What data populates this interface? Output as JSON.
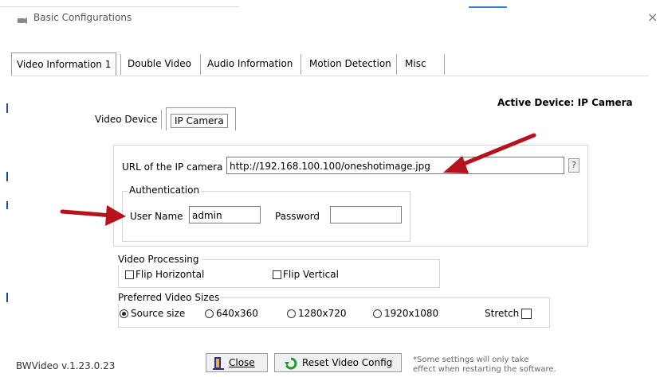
{
  "window": {
    "title": "Basic Configurations",
    "close_glyph": "×"
  },
  "tabs": [
    {
      "label": "Video Information 1",
      "active": true
    },
    {
      "label": "Double Video",
      "active": false
    },
    {
      "label": "Audio Information",
      "active": false
    },
    {
      "label": "Motion Detection",
      "active": false
    },
    {
      "label": "Misc",
      "active": false
    }
  ],
  "active_device": "Active Device: IP Camera",
  "subtabs": {
    "video_device": "Video Device",
    "ip_camera": "IP Camera"
  },
  "ip_camera": {
    "url_label": "URL of the IP camera",
    "url_value": "http://192.168.100.100/oneshotimage.jpg",
    "help_label": "?",
    "auth_legend": "Authentication",
    "user_label": "User Name",
    "user_value": "admin",
    "password_label": "Password",
    "password_value": ""
  },
  "video_processing": {
    "legend": "Video Processing",
    "flip_horizontal": "Flip Horizontal",
    "flip_vertical": "Flip Vertical"
  },
  "video_sizes": {
    "legend": "Preferred Video Sizes",
    "options": [
      "Source size",
      "640x360",
      "1280x720",
      "1920x1080"
    ],
    "selected": "Source size",
    "stretch_label": "Stretch"
  },
  "footer": {
    "version": "BWVideo v.1.23.0.23",
    "close_label": "Close",
    "reset_label": "Reset Video Config",
    "note_line1": "*Some settings will only take",
    "note_line2": "effect when restarting the software."
  },
  "colors": {
    "annotation_arrow": "#b5121b",
    "reset_icon": "#1e9e2e"
  }
}
